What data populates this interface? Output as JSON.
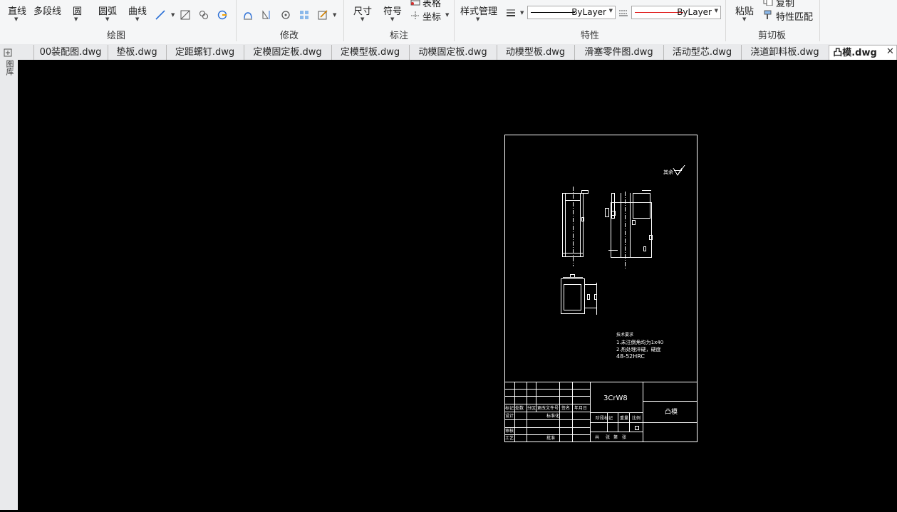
{
  "ribbon": {
    "draw": {
      "line": "直线",
      "polyline": "多段线",
      "circle": "圆",
      "arc": "圆弧",
      "curve": "曲线",
      "group": "绘图"
    },
    "modify": {
      "group": "修改"
    },
    "annotate": {
      "dimension": "尺寸",
      "symbol": "符号",
      "table": "表格",
      "coordinate": "坐标",
      "group": "标注"
    },
    "properties": {
      "style_manager": "样式管理",
      "linetype": "ByLayer",
      "color": "ByLayer",
      "group": "特性"
    },
    "clipboard": {
      "paste": "粘贴",
      "copy": "复制",
      "match": "特性匹配",
      "group": "剪切板"
    }
  },
  "tabs": [
    "00装配图.dwg",
    "垫板.dwg",
    "定距螺钉.dwg",
    "定模固定板.dwg",
    "定模型板.dwg",
    "动模固定板.dwg",
    "动模型板.dwg",
    "滑塞零件图.dwg",
    "活动型芯.dwg",
    "浇道卸料板.dwg",
    "凸模.dwg"
  ],
  "active_tab": "凸模.dwg",
  "side_label": "图库",
  "drawing": {
    "surface_mark": "其余",
    "notes": [
      "技术要求",
      "1.未注倒角均为1x40",
      "2.热处理淬硬，硬度",
      "48-52HRC"
    ],
    "material": "3CrW8",
    "part_name": "凸模",
    "title_block": {
      "row1": [
        "标记",
        "处数",
        "分区",
        "更改文件号",
        "签名",
        "年月日"
      ],
      "design": "设计",
      "standardize": "标准化",
      "review": "审核",
      "process": "工艺",
      "approve": "批准",
      "stage": "阶段标记",
      "weight": "重量",
      "scale": "比例",
      "sheets": [
        "共",
        "张",
        "第",
        "张"
      ]
    }
  },
  "colors": {
    "canvas": "#000000",
    "drawing_lines": "#ffffff",
    "color_sample": "#e02020"
  }
}
